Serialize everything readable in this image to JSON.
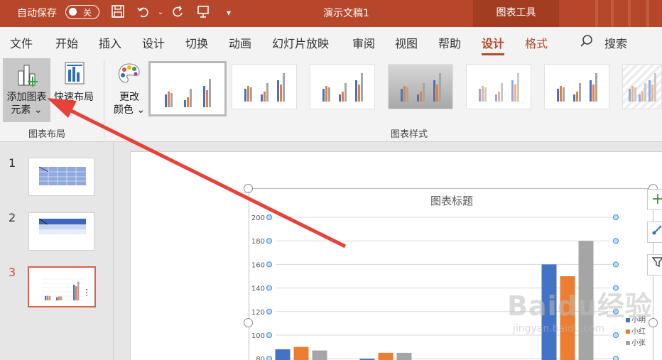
{
  "titlebar": {
    "autosave_label": "自动保存",
    "autosave_state": "关",
    "doc_title": "演示文稿1",
    "context_tab": "图表工具"
  },
  "menu": {
    "items": [
      "文件",
      "开始",
      "插入",
      "设计",
      "切换",
      "动画",
      "幻灯片放映",
      "审阅",
      "视图",
      "帮助"
    ],
    "active": "设计",
    "format": "格式",
    "search": "搜索"
  },
  "ribbon": {
    "add_element_line1": "添加图表",
    "add_element_line2": "元素",
    "quick_layout": "快速布局",
    "change_color_line1": "更改",
    "change_color_line2": "颜色",
    "group_layout": "图表布局",
    "group_styles": "图表样式"
  },
  "slides": {
    "numbers": [
      "1",
      "2",
      "3"
    ],
    "active": "3"
  },
  "chart_data": {
    "type": "bar",
    "title": "图表标题",
    "ylim": [
      80,
      200
    ],
    "yticks": [
      80,
      100,
      120,
      140,
      160,
      180,
      200
    ],
    "grid": true,
    "legend_position": "right",
    "series": [
      {
        "name": "小明",
        "color": "#4472c4",
        "values": [
          88,
          80,
          160
        ]
      },
      {
        "name": "小红",
        "color": "#ed7d31",
        "values": [
          90,
          85,
          150
        ]
      },
      {
        "name": "小张",
        "color": "#a5a5a5",
        "values": [
          87,
          85,
          180
        ]
      }
    ]
  },
  "watermark": {
    "text": "Baidu经验",
    "url": "jingyan.baidu.com"
  }
}
